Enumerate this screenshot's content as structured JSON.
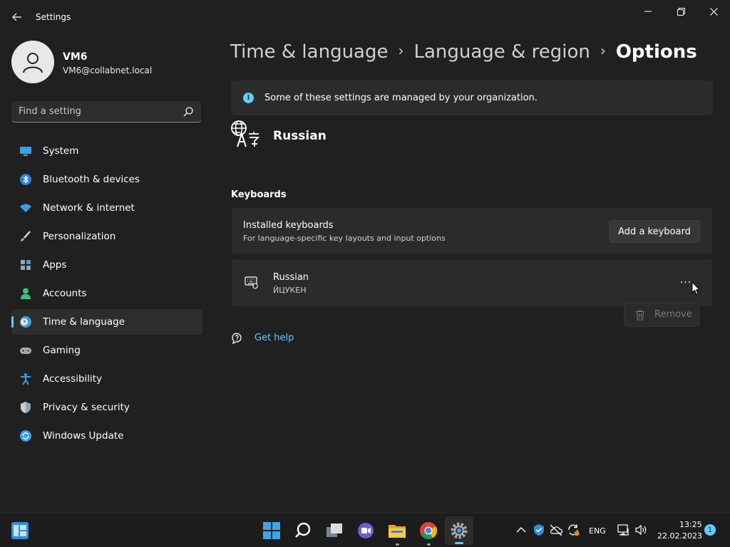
{
  "window": {
    "title": "Settings"
  },
  "user": {
    "name": "VM6",
    "email": "VM6@collabnet.local"
  },
  "search": {
    "placeholder": "Find a setting"
  },
  "sidebar": {
    "items": [
      {
        "label": "System",
        "icon": "monitor-icon"
      },
      {
        "label": "Bluetooth & devices",
        "icon": "bluetooth-icon"
      },
      {
        "label": "Network & internet",
        "icon": "wifi-icon"
      },
      {
        "label": "Personalization",
        "icon": "brush-icon"
      },
      {
        "label": "Apps",
        "icon": "apps-icon"
      },
      {
        "label": "Accounts",
        "icon": "person-icon"
      },
      {
        "label": "Time & language",
        "icon": "clock-globe-icon",
        "selected": true
      },
      {
        "label": "Gaming",
        "icon": "gamepad-icon"
      },
      {
        "label": "Accessibility",
        "icon": "accessibility-icon"
      },
      {
        "label": "Privacy & security",
        "icon": "shield-icon"
      },
      {
        "label": "Windows Update",
        "icon": "update-icon"
      }
    ]
  },
  "breadcrumb": {
    "level1": "Time & language",
    "level2": "Language & region",
    "current": "Options",
    "separator": "›"
  },
  "info_bar": {
    "text": "Some of these settings are managed by your organization."
  },
  "language": {
    "name": "Russian"
  },
  "keyboards": {
    "section_title": "Keyboards",
    "installed_title": "Installed keyboards",
    "installed_subtitle": "For language-specific key layouts and input options",
    "add_button": "Add a keyboard",
    "items": [
      {
        "name": "Russian",
        "layout": "ЙЦУКЕН"
      }
    ],
    "more_label": "···",
    "remove_label": "Remove"
  },
  "help": {
    "label": "Get help"
  },
  "tray": {
    "language": "ENG",
    "time": "13:25",
    "date": "22.02.2023",
    "notifications": "1"
  },
  "colors": {
    "accent": "#60cdff",
    "background": "#202020",
    "card": "#2b2b2b"
  }
}
